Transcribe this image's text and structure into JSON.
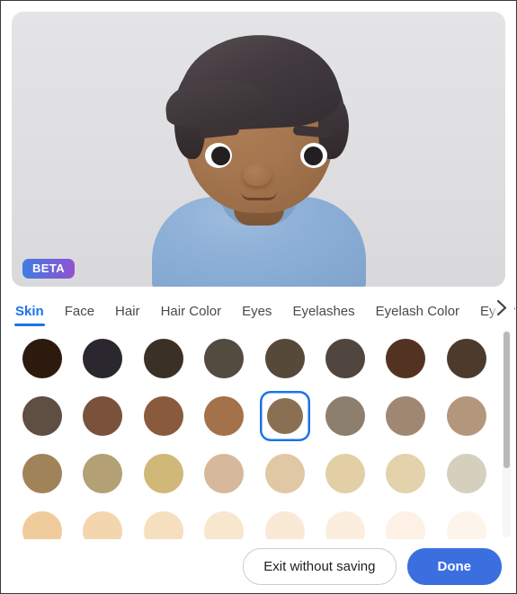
{
  "preview": {
    "badge": "BETA",
    "avatar": {
      "skin_color": "#a5764f",
      "hair_color": "#3b3438",
      "shirt_color": "#8cafd6",
      "background_color": "#e1e1e3"
    }
  },
  "tabs": {
    "items": [
      {
        "label": "Skin",
        "active": true
      },
      {
        "label": "Face",
        "active": false
      },
      {
        "label": "Hair",
        "active": false
      },
      {
        "label": "Hair Color",
        "active": false
      },
      {
        "label": "Eyes",
        "active": false
      },
      {
        "label": "Eyelashes",
        "active": false
      },
      {
        "label": "Eyelash Color",
        "active": false
      },
      {
        "label": "Eyebrows",
        "active": false
      }
    ],
    "scroll_next_icon": "chevron-right-icon",
    "active_color": "#1a73e8"
  },
  "swatches": {
    "selected_index": 12,
    "selection_ring_color": "#1a73e8",
    "colors": [
      "#2d1a0e",
      "#2b272f",
      "#3a3026",
      "#534a40",
      "#55493a",
      "#50453f",
      "#543222",
      "#4c3a2d",
      "#5f4e42",
      "#7a513a",
      "#8a5a3c",
      "#a3714a",
      "#8a7052",
      "#8d7f6d",
      "#a08771",
      "#b2977c",
      "#a08358",
      "#b3a074",
      "#cfb878",
      "#d6b99a",
      "#e0c8a4",
      "#e2cfa6",
      "#e3d2ab",
      "#d5d0bd",
      "#f0cb9c",
      "#f3d6ae",
      "#f6dfbe",
      "#f8e6cd",
      "#fae9d6",
      "#fbeede",
      "#fcf1e4",
      "#fdf5ec"
    ]
  },
  "actions": {
    "exit_label": "Exit without saving",
    "done_label": "Done",
    "primary_color": "#3b6fe0"
  }
}
